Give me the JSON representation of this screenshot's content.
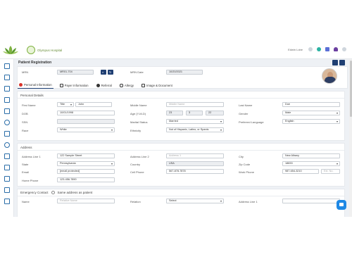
{
  "header": {
    "hospital_name": "Olympus Hospital",
    "user_name": "Edwin Lobe"
  },
  "page": {
    "title": "Patient Registration",
    "mrn_label": "MRN",
    "mrn_value": "MR01-704",
    "mrn_date_label": "MRN Date",
    "mrn_date_value": "10/20/2021"
  },
  "tabs": [
    {
      "label": "Personal Information",
      "active": true
    },
    {
      "label": "Payer Information",
      "active": false
    },
    {
      "label": "Referral",
      "active": false
    },
    {
      "label": "Allergy",
      "active": false
    },
    {
      "label": "Image & Document",
      "active": false
    }
  ],
  "personal": {
    "section_title": "Personal Details",
    "first_name_label": "First Name",
    "title_value": "Title",
    "first_name_value": "John",
    "middle_name_label": "Middle Name",
    "middle_name_placeholder": "Middle Name",
    "last_name_label": "Last Name",
    "last_name_value": "Doe",
    "dob_label": "DOB",
    "dob_value": "10/01/1998",
    "age_label": "Age (Y-M-D)",
    "age_y": "23",
    "age_m": "3",
    "age_d": "22",
    "gender_label": "Gender",
    "gender_value": "Male",
    "ssn_label": "SSN",
    "marital_label": "Marital Status",
    "marital_value": "Married",
    "language_label": "Preferred Language",
    "language_value": "English",
    "race_label": "Race",
    "race_value": "White",
    "ethnicity_label": "Ethnicity",
    "ethnicity_value": "Not of Hispanic, Latino, or Spanis"
  },
  "address": {
    "section_title": "Address",
    "line1_label": "Address Line 1",
    "line1_value": "122 Sample Street",
    "line2_label": "Address Line 2",
    "line2_placeholder": "Address 1",
    "city_label": "City",
    "city_value": "New Albany",
    "state_label": "State",
    "state_value": "Pennsylvania",
    "country_label": "Country",
    "country_value": "USA",
    "zip_label": "Zip Code",
    "zip_value": "18833",
    "email_label": "Email",
    "email_value": "[email protected]",
    "cell_label": "Cell Phone",
    "cell_value": "567-878-7878",
    "work_label": "Work Phone",
    "work_value": "987-654-3210",
    "ext_placeholder": "Ext. No.",
    "home_label": "Home Phone",
    "home_value": "123-456-7890"
  },
  "emergency": {
    "section_title": "Emergency Contact",
    "same_address_label": "Same address as patient",
    "name_label": "Name",
    "name_placeholder": "Relative Name",
    "relation_label": "Relation",
    "relation_value": "Select",
    "line1_label": "Address Line 1"
  },
  "colors": {
    "navy": "#1f3f73",
    "accent": "#1e88e5",
    "brand_green": "#7fb241"
  }
}
